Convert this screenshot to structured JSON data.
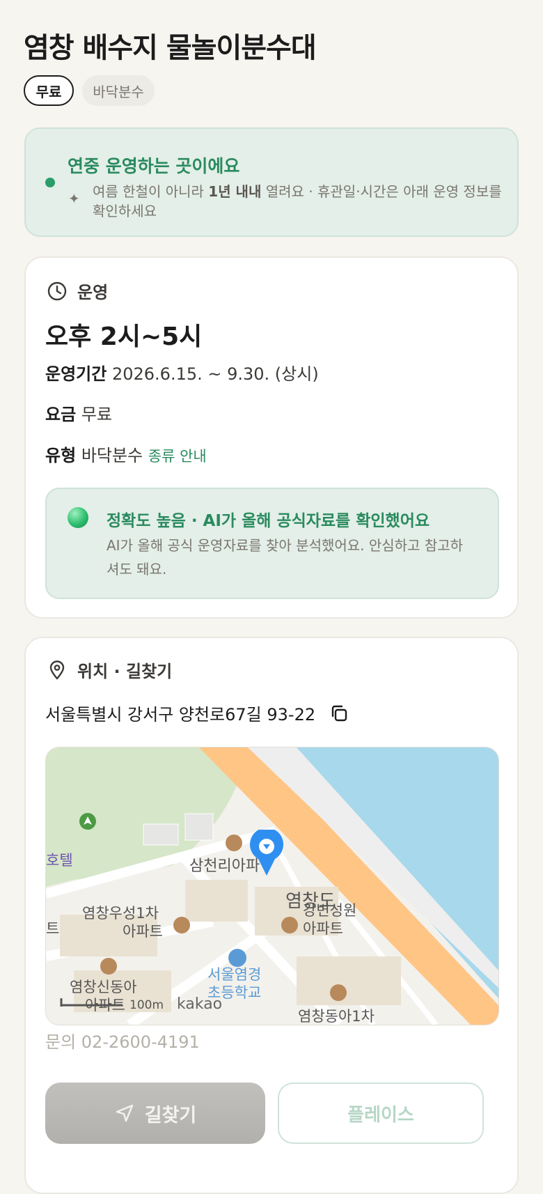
{
  "header": {
    "title": "염창 배수지 물놀이분수대"
  },
  "chips": {
    "price": "무료",
    "type": "바닥분수"
  },
  "banner": {
    "title": "연중 운영하는 곳이에요",
    "desc_before": "여름 한철이 아니라 ",
    "desc_bold": "1년 내내",
    "desc_after": " 열려요 · 휴관일·시간은 아래 운영 정보를 확인하세요"
  },
  "operation": {
    "section_label": "운영",
    "hours": "오후 2시~5시",
    "period_label": "운영기간",
    "period_value": "2026.6.15. ~ 9.30. (상시)",
    "fee_label": "요금",
    "fee_value": "무료",
    "type_label": "유형",
    "type_value": "바닥분수",
    "type_link": "종류 안내",
    "ai": {
      "title": "정확도 높음 · AI가 올해 공식자료를 확인했어요",
      "desc": "AI가 올해 공식 운영자료를 찾아 분석했어요. 안심하고 참고하셔도 돼요."
    }
  },
  "location": {
    "section_label": "위치 · 길찾기",
    "address": "서울특별시 강서구 양천로67길 93-22",
    "map": {
      "labels": [
        "삼천리아파",
        "염창도",
        "강변성원",
        "아파트",
        "염창우성1차",
        "아파트",
        "염창신동아",
        "아파트",
        "서울염경",
        "초등학교",
        "염창동아1차",
        "호텔",
        "트"
      ],
      "scale": "100m",
      "brand": "kakao"
    },
    "phone": "문의 02-2600-4191"
  },
  "actions": {
    "directions": "길찾기",
    "place": "플레이스"
  },
  "colors": {
    "accent": "#2a8a5e",
    "banner_bg": "#e3efe8",
    "pin": "#2f8ff0",
    "water": "#a7d8ec",
    "road": "#ffc585"
  }
}
